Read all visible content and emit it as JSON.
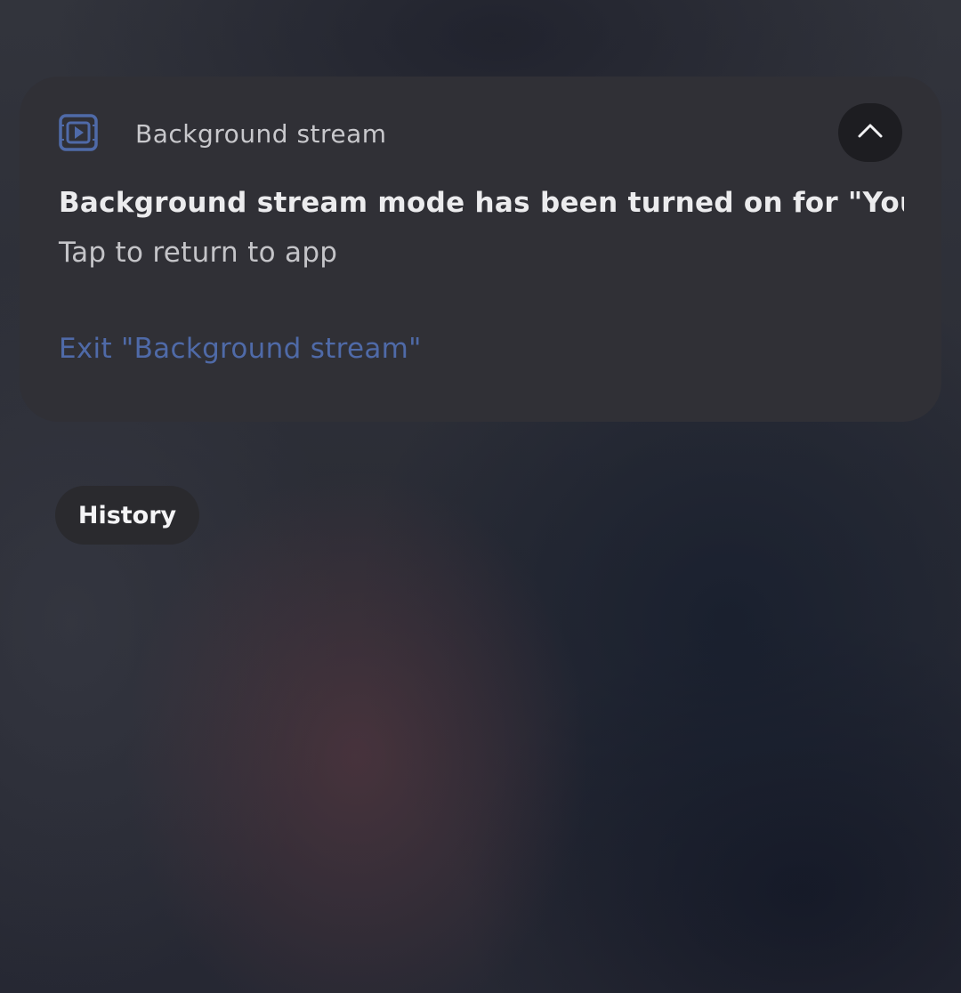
{
  "notification": {
    "app_name": "Background stream",
    "app_icon": "play-in-frame-icon",
    "collapse_icon": "chevron-up-icon",
    "title": "Background stream mode has been turned on for \"You..",
    "subtitle": "Tap to return to app",
    "action_label": "Exit \"Background stream\""
  },
  "history": {
    "label": "History"
  },
  "colors": {
    "accent": "#4f6aa8",
    "card_background": "#303036",
    "chip_background": "#2a2a2e"
  }
}
